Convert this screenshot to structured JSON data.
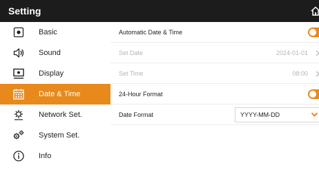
{
  "header": {
    "title": "Setting",
    "home_icon": "home-icon"
  },
  "colors": {
    "accent": "#e8891b",
    "titlebar": "#1c1c1c",
    "disabled_text": "#b5b5b5"
  },
  "sidebar": {
    "active_index": 3,
    "items": [
      {
        "label": "Basic",
        "icon": "basic-icon"
      },
      {
        "label": "Sound",
        "icon": "speaker-icon"
      },
      {
        "label": "Display",
        "icon": "monitor-icon"
      },
      {
        "label": "Date & Time",
        "icon": "calendar-icon"
      },
      {
        "label": "Network Set.",
        "icon": "network-icon"
      },
      {
        "label": "System Set.",
        "icon": "gears-icon"
      },
      {
        "label": "Info",
        "icon": "info-icon"
      }
    ]
  },
  "settings": {
    "auto_datetime": {
      "label": "Automatic Date & Time",
      "enabled": true
    },
    "set_date": {
      "label": "Set Date",
      "value": "2024-01-01",
      "disabled": true
    },
    "set_time": {
      "label": "Set Time",
      "value": "08:00",
      "disabled": true
    },
    "hour24": {
      "label": "24-Hour Format",
      "enabled": true
    },
    "date_format": {
      "label": "Date Format",
      "value": "YYYY-MM-DD"
    }
  }
}
